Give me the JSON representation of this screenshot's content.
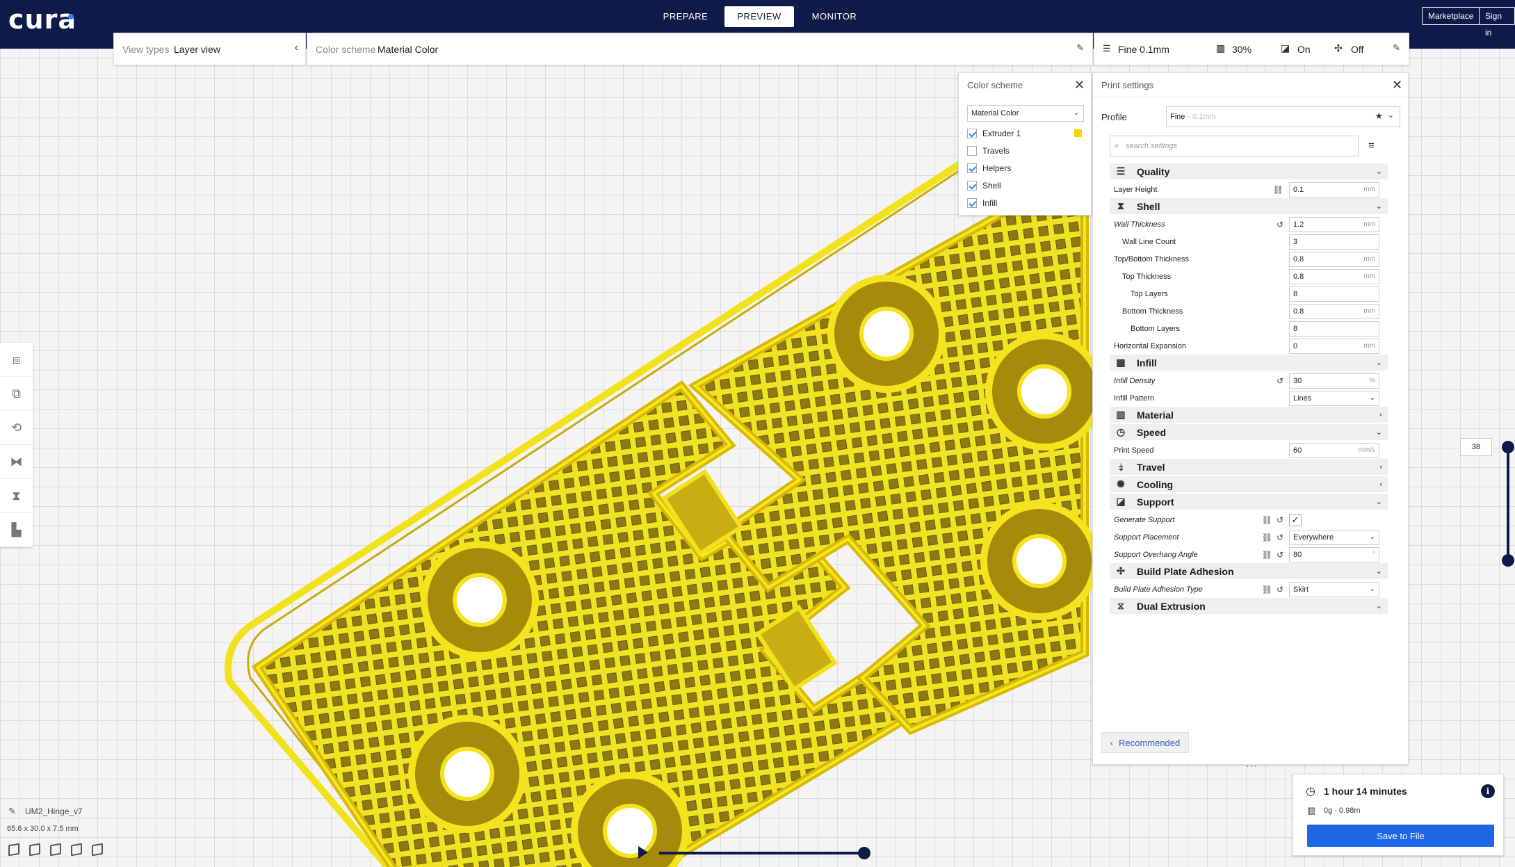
{
  "app": {
    "logo_text": "cura"
  },
  "stages": [
    {
      "label": "PREPARE",
      "active": false
    },
    {
      "label": "PREVIEW",
      "active": true
    },
    {
      "label": "MONITOR",
      "active": false
    }
  ],
  "top_buttons": {
    "marketplace": "Marketplace",
    "sign_in": "Sign in"
  },
  "view_types": {
    "label": "View types",
    "value": "Layer view"
  },
  "color_scheme_header": {
    "label": "Color scheme",
    "value": "Material Color"
  },
  "print_summary": {
    "profile": "Fine 0.1mm",
    "infill": "30%",
    "support": "On",
    "adhesion": "Off"
  },
  "color_scheme_panel": {
    "title": "Color scheme",
    "selected": "Material Color",
    "items": [
      {
        "label": "Extruder 1",
        "checked": true,
        "swatch": "#f7d400"
      },
      {
        "label": "Travels",
        "checked": false
      },
      {
        "label": "Helpers",
        "checked": true
      },
      {
        "label": "Shell",
        "checked": true
      },
      {
        "label": "Infill",
        "checked": true
      }
    ]
  },
  "print_settings": {
    "title": "Print settings",
    "profile_label": "Profile",
    "profile_value": "Fine",
    "profile_sub": "- 0.1mm",
    "search_placeholder": "search settings",
    "recommended_label": "Recommended",
    "sections": [
      {
        "type": "category",
        "name": "Quality",
        "icon": "quality-icon",
        "expanded": true
      },
      {
        "type": "setting",
        "name": "Layer Height",
        "value": "0.1",
        "unit": "mm",
        "indent": 0,
        "italic": false,
        "link": true,
        "reset": false
      },
      {
        "type": "category",
        "name": "Shell",
        "icon": "shell-icon",
        "expanded": true
      },
      {
        "type": "setting",
        "name": "Wall Thickness",
        "value": "1.2",
        "unit": "mm",
        "indent": 0,
        "italic": true,
        "link": false,
        "reset": true
      },
      {
        "type": "setting",
        "name": "Wall Line Count",
        "value": "3",
        "unit": "",
        "indent": 1,
        "italic": false,
        "link": false,
        "reset": false
      },
      {
        "type": "setting",
        "name": "Top/Bottom Thickness",
        "value": "0.8",
        "unit": "mm",
        "indent": 0,
        "italic": false,
        "link": false,
        "reset": false
      },
      {
        "type": "setting",
        "name": "Top Thickness",
        "value": "0.8",
        "unit": "mm",
        "indent": 1,
        "italic": false,
        "link": false,
        "reset": false
      },
      {
        "type": "setting",
        "name": "Top Layers",
        "value": "8",
        "unit": "",
        "indent": 2,
        "italic": false,
        "link": false,
        "reset": false
      },
      {
        "type": "setting",
        "name": "Bottom Thickness",
        "value": "0.8",
        "unit": "mm",
        "indent": 1,
        "italic": false,
        "link": false,
        "reset": false
      },
      {
        "type": "setting",
        "name": "Bottom Layers",
        "value": "8",
        "unit": "",
        "indent": 2,
        "italic": false,
        "link": false,
        "reset": false
      },
      {
        "type": "setting",
        "name": "Horizontal Expansion",
        "value": "0",
        "unit": "mm",
        "indent": 0,
        "italic": false,
        "link": false,
        "reset": false
      },
      {
        "type": "category",
        "name": "Infill",
        "icon": "infill-icon",
        "expanded": true
      },
      {
        "type": "setting",
        "name": "Infill Density",
        "value": "30",
        "unit": "%",
        "indent": 0,
        "italic": true,
        "link": false,
        "reset": true
      },
      {
        "type": "setting",
        "name": "Infill Pattern",
        "value": "Lines",
        "unit": "",
        "indent": 0,
        "italic": false,
        "link": false,
        "reset": false,
        "dropdown": true
      },
      {
        "type": "category",
        "name": "Material",
        "icon": "material-icon",
        "expanded": false
      },
      {
        "type": "category",
        "name": "Speed",
        "icon": "speed-icon",
        "expanded": true
      },
      {
        "type": "setting",
        "name": "Print Speed",
        "value": "60",
        "unit": "mm/s",
        "indent": 0,
        "italic": false,
        "link": false,
        "reset": false
      },
      {
        "type": "category",
        "name": "Travel",
        "icon": "travel-icon",
        "expanded": false
      },
      {
        "type": "category",
        "name": "Cooling",
        "icon": "cooling-icon",
        "expanded": false
      },
      {
        "type": "category",
        "name": "Support",
        "icon": "support-icon",
        "expanded": true
      },
      {
        "type": "setting",
        "name": "Generate Support",
        "value": "",
        "unit": "",
        "indent": 0,
        "italic": true,
        "link": true,
        "reset": true,
        "checkbox": true
      },
      {
        "type": "setting",
        "name": "Support Placement",
        "value": "Everywhere",
        "unit": "",
        "indent": 0,
        "italic": true,
        "link": true,
        "reset": true,
        "dropdown": true
      },
      {
        "type": "setting",
        "name": "Support Overhang Angle",
        "value": "80",
        "unit": "°",
        "indent": 0,
        "italic": true,
        "link": true,
        "reset": true
      },
      {
        "type": "category",
        "name": "Build Plate Adhesion",
        "icon": "adhesion-icon",
        "expanded": true
      },
      {
        "type": "setting",
        "name": "Build Plate Adhesion Type",
        "value": "Skirt",
        "unit": "",
        "indent": 0,
        "italic": true,
        "link": true,
        "reset": true,
        "dropdown": true
      },
      {
        "type": "category",
        "name": "Dual Extrusion",
        "icon": "dual-extrusion-icon",
        "expanded": true
      }
    ]
  },
  "layer_slider": {
    "current_layer": "38"
  },
  "object": {
    "name": "UM2_Hinge_v7",
    "dimensions": "65.6 x 30.0 x 7.5 mm"
  },
  "output": {
    "time": "1 hour 14 minutes",
    "material": "0g · 0.98m",
    "save_label": "Save to File"
  },
  "colors": {
    "topbar": "#0e1a4a",
    "accent": "#1e66e8",
    "filament": "#f7e21b"
  }
}
